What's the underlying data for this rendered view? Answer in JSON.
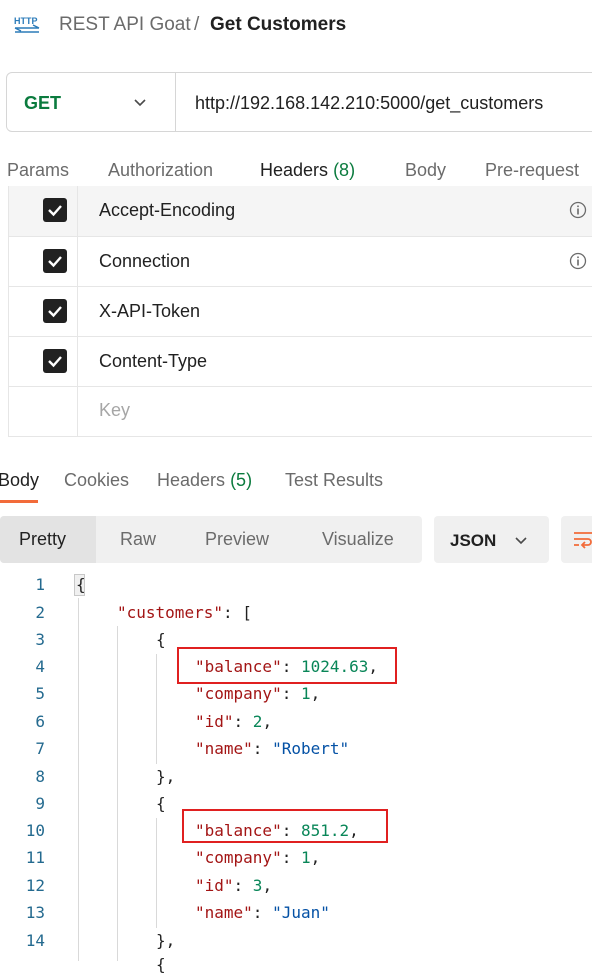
{
  "breadcrumb": {
    "icon": "http-icon",
    "parent": "REST API Goat",
    "separator": "/",
    "current": "Get Customers"
  },
  "request": {
    "method": "GET",
    "url": "http://192.168.142.210:5000/get_customers"
  },
  "request_tabs": [
    {
      "label": "Params",
      "count": ""
    },
    {
      "label": "Authorization",
      "count": ""
    },
    {
      "label": "Headers",
      "count": "(8)",
      "active": true
    },
    {
      "label": "Body",
      "count": ""
    },
    {
      "label": "Pre-request",
      "count": ""
    }
  ],
  "headers_table": {
    "rows": [
      {
        "key": "Accept-Encoding",
        "checked": true,
        "info": true
      },
      {
        "key": "Connection",
        "checked": true,
        "info": true
      },
      {
        "key": "X-API-Token",
        "checked": true,
        "info": false
      },
      {
        "key": "Content-Type",
        "checked": true,
        "info": false
      }
    ],
    "new_key_placeholder": "Key"
  },
  "response_tabs": [
    {
      "label": "Body",
      "count": "",
      "active": true
    },
    {
      "label": "Cookies",
      "count": ""
    },
    {
      "label": "Headers",
      "count": "(5)"
    },
    {
      "label": "Test Results",
      "count": ""
    }
  ],
  "view_modes": [
    "Pretty",
    "Raw",
    "Preview",
    "Visualize"
  ],
  "active_view_mode": "Pretty",
  "format": "JSON",
  "code": {
    "line_numbers": [
      "1",
      "2",
      "3",
      "4",
      "5",
      "6",
      "7",
      "8",
      "9",
      "10",
      "11",
      "12",
      "13",
      "14"
    ],
    "root_key": "customers",
    "customers": [
      {
        "balance": "1024.63",
        "company": "1",
        "id": "2",
        "name": "Robert"
      },
      {
        "balance": "851.2",
        "company": "1",
        "id": "3",
        "name": "Juan"
      }
    ]
  },
  "colors": {
    "accent": "#f26b3a",
    "method": "#0b7b3e",
    "highlight_box": "#e02020",
    "json_key": "#a31515",
    "json_number": "#098658",
    "json_string": "#0451a5"
  }
}
